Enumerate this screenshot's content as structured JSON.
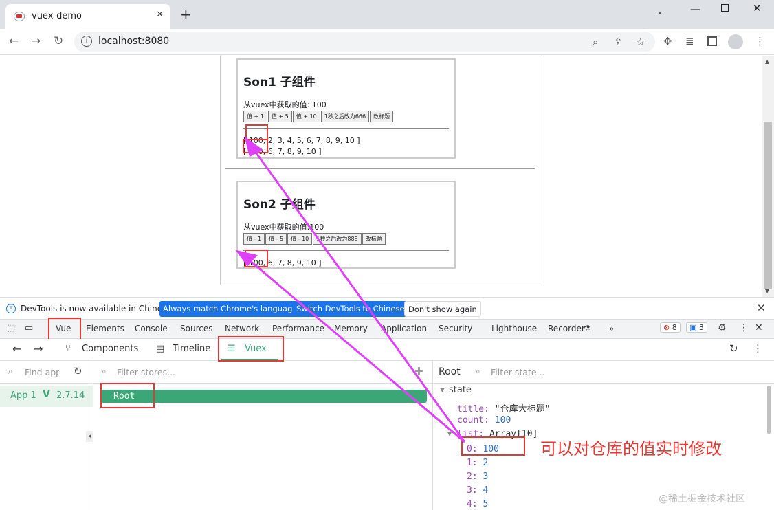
{
  "browser": {
    "tab_title": "vuex-demo",
    "url": "localhost:8080",
    "new_tab_label": "+"
  },
  "page": {
    "son1": {
      "title": "Son1 子组件",
      "value_text": "从vuex中获取的值: 100",
      "buttons": [
        "值 + 1",
        "值 + 5",
        "值 + 10",
        "1秒之后改为666",
        "改标题"
      ],
      "list_full": "[ 100, 2, 3, 4, 5, 6, 7, 8, 9, 10 ]",
      "list_filtered": "[ 100, 6, 7, 8, 9, 10 ]"
    },
    "son2": {
      "title": "Son2 子组件",
      "value_text": "从vuex中获取的值:100",
      "buttons": [
        "值 - 1",
        "值 - 5",
        "值 - 10",
        "1秒之后改为888",
        "改标题"
      ],
      "list_filtered": "[ 100, 6, 7, 8, 9, 10 ]"
    }
  },
  "infobar": {
    "message": "DevTools is now available in Chinese!",
    "btn_match": "Always match Chrome's language",
    "btn_switch": "Switch DevTools to Chinese",
    "btn_dismiss": "Don't show again"
  },
  "devtools_tabs": [
    "Vue",
    "Elements",
    "Console",
    "Sources",
    "Network",
    "Performance",
    "Memory",
    "Application",
    "Security",
    "Lighthouse",
    "Recorder"
  ],
  "badges": {
    "errors": "8",
    "messages": "3"
  },
  "vue_toolbar": {
    "components": "Components",
    "timeline": "Timeline",
    "vuex": "Vuex"
  },
  "left_panel": {
    "find_placeholder": "Find apps",
    "app_name": "App 1",
    "vue_version": "2.7.14"
  },
  "mid_panel": {
    "filter_placeholder": "Filter stores...",
    "root_label": "Root"
  },
  "right_panel": {
    "header": "Root",
    "filter_placeholder": "Filter state...",
    "state_label": "state",
    "title_key": "title:",
    "title_value": "\"仓库大标题\"",
    "count_key": "count:",
    "count_value": "100",
    "list_key": "list:",
    "list_value": "Array[10]",
    "items": [
      {
        "k": "0:",
        "v": "100"
      },
      {
        "k": "1:",
        "v": "2"
      },
      {
        "k": "2:",
        "v": "3"
      },
      {
        "k": "3:",
        "v": "4"
      },
      {
        "k": "4:",
        "v": "5"
      }
    ]
  },
  "annotation": "可以对仓库的值实时修改",
  "watermark": "@稀土掘金技术社区",
  "colors": {
    "accent_red": "#e53935",
    "vue_green": "#3ba776",
    "chrome_blue": "#1a73e8"
  }
}
